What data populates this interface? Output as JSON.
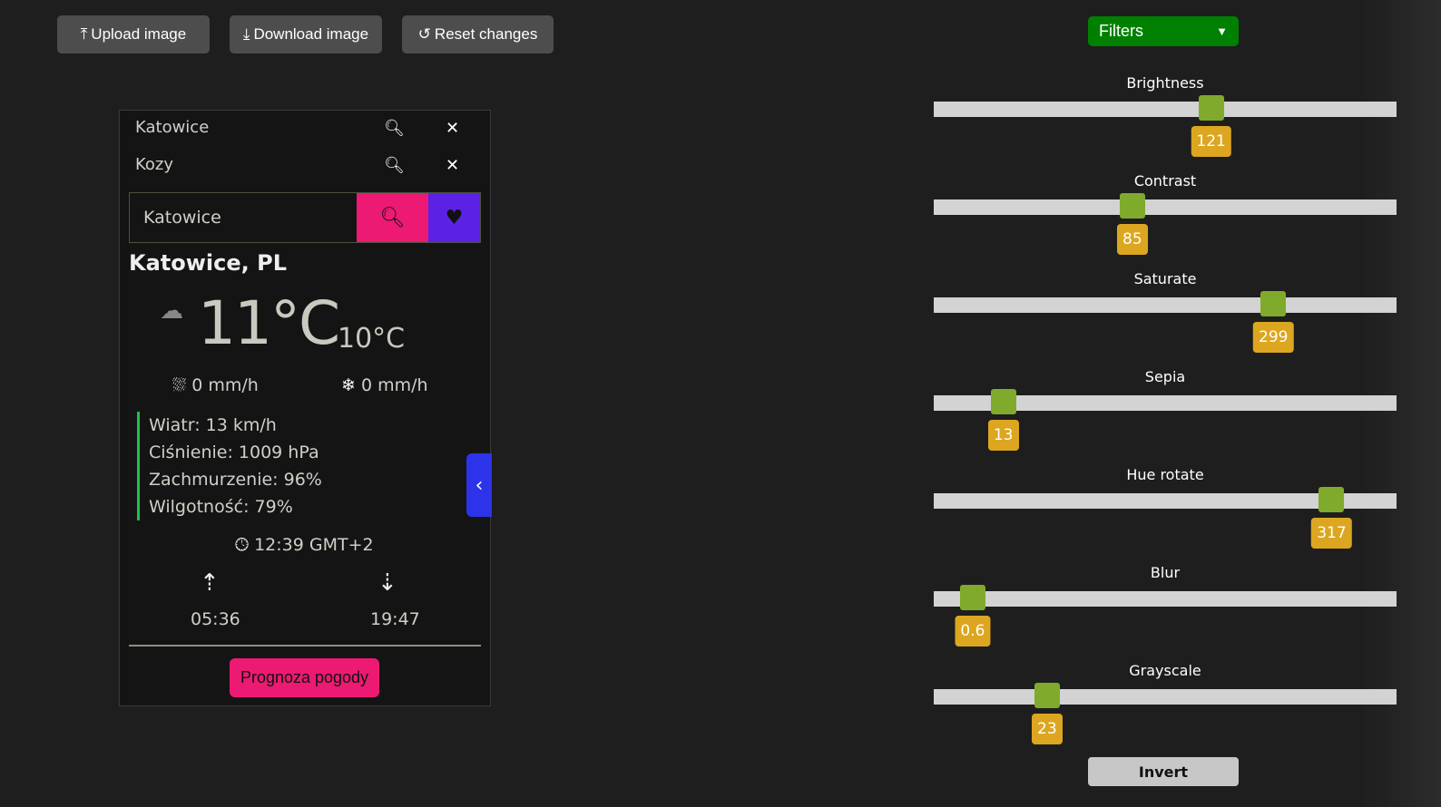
{
  "toolbar": {
    "upload": "Upload image",
    "download": "Download image",
    "reset": "Reset changes"
  },
  "weather": {
    "history": [
      {
        "city": "Katowice"
      },
      {
        "city": "Kozy"
      }
    ],
    "search_value": "Katowice",
    "location": "Katowice, PL",
    "temp": "11°C",
    "feels_like": "10°C",
    "rain": "0 mm/h",
    "snow": "0 mm/h",
    "details": [
      "Wiatr: 13 km/h",
      "Ciśnienie: 1009 hPa",
      "Zachmurzenie: 96%",
      "Wilgotność: 79%"
    ],
    "time": "12:39 GMT+2",
    "sunrise": "05:36",
    "sunset": "19:47",
    "forecast_button": "Prognoza pogody"
  },
  "filters": {
    "dropdown": "Filters",
    "sliders": [
      {
        "label": "Brightness",
        "value": 121,
        "display": "121",
        "max": 200
      },
      {
        "label": "Contrast",
        "value": 85,
        "display": "85",
        "max": 200
      },
      {
        "label": "Saturate",
        "value": 299,
        "display": "299",
        "max": 400
      },
      {
        "label": "Sepia",
        "value": 13,
        "display": "13",
        "max": 100
      },
      {
        "label": "Hue rotate",
        "value": 317,
        "display": "317",
        "max": 360
      },
      {
        "label": "Blur",
        "value": 0.6,
        "display": "0.6",
        "max": 10
      },
      {
        "label": "Grayscale",
        "value": 23,
        "display": "23",
        "max": 100
      }
    ],
    "invert": "Invert"
  },
  "colors": {
    "accent_pink": "#ec1a72",
    "accent_purple": "#5b22e6",
    "filters_green": "#008000",
    "thumb": "#80aa2c",
    "badge": "#dca620"
  }
}
